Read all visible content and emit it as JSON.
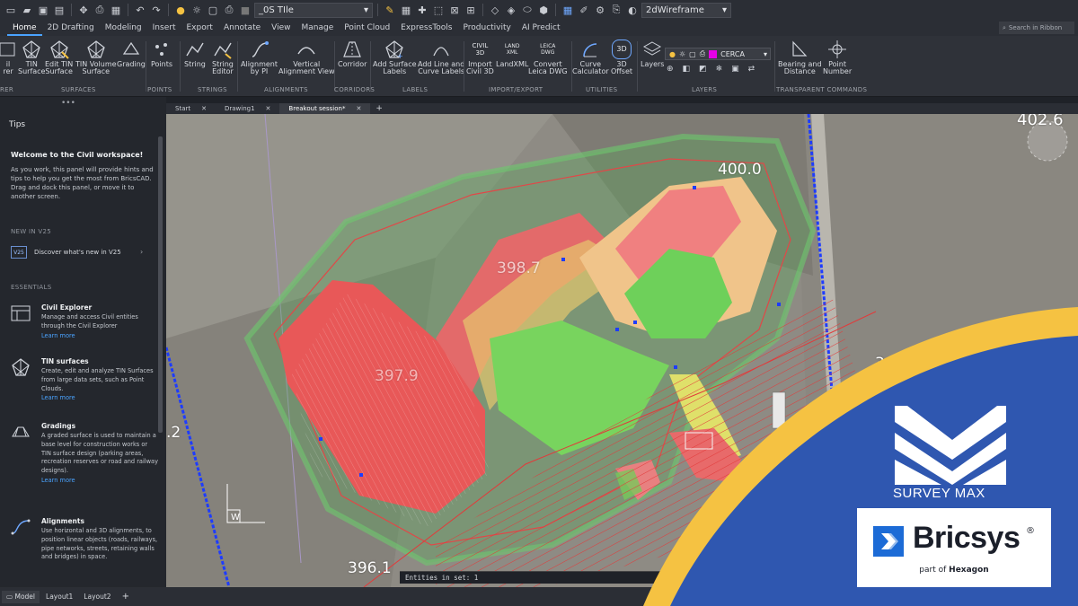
{
  "quick_access": {
    "file_name": "_0S TIle",
    "visual_style": "2dWireframe"
  },
  "menu": {
    "tabs": [
      "Home",
      "2D Drafting",
      "Modeling",
      "Insert",
      "Export",
      "Annotate",
      "View",
      "Manage",
      "Point Cloud",
      "ExpressTools",
      "Productivity",
      "AI Predict"
    ],
    "active": "Home",
    "search_placeholder": "Search in Ribbon"
  },
  "ribbon": {
    "tools": {
      "civil_explorer": "il\nrer",
      "tin_surface": "TIN\nSurface",
      "edit_tin_surface": "Edit TIN\nSurface",
      "tin_volume_surface": "TIN Volume\nSurface",
      "grading": "Grading",
      "points": "Points",
      "string": "String",
      "string_editor": "String\nEditor",
      "alignment_by_pi": "Alignment\nby PI",
      "vertical_alignment_view": "Vertical\nAlignment View",
      "corridor": "Corridor",
      "add_surface_labels": "Add Surface\nLabels",
      "add_line_curve_labels": "Add Line and\nCurve Labels",
      "import_civil3d": "Import\nCivil 3D",
      "landxml": "LandXML",
      "convert_leica": "Convert\nLeica DWG",
      "curve_calculator": "Curve\nCalculator",
      "offset_3d": "3D\nOffset",
      "layers": "Layers",
      "bearing_distance": "Bearing and\nDistance",
      "point_number": "Point\nNumber"
    },
    "icon_tags": {
      "civil": "CIVIL",
      "civil_3d": "3D",
      "land": "LAND",
      "xml": "XML",
      "leica": "LEICA",
      "dwg": "DWG",
      "offset_3d": "3D"
    },
    "groups": {
      "explorer": "RER",
      "surfaces": "SURFACES",
      "points": "POINTS",
      "strings": "STRINGS",
      "alignments": "ALIGNMENTS",
      "corridors": "CORRIDORS",
      "labels": "LABELS",
      "import_export": "IMPORT/EXPORT",
      "utilities": "UTILITIES",
      "layers": "LAYERS",
      "transparent": "TRANSPARENT COMMANDS"
    },
    "current_layer": "CERCA",
    "layer_color": "#e600e6"
  },
  "tips_panel": {
    "title": "Tips",
    "welcome_title": "Welcome to the Civil workspace!",
    "welcome_text": "As you work, this panel will provide hints and tips to help you get the most from BricsCAD. Drag and dock this panel, or move it to another screen.",
    "new_section": "NEW IN V25",
    "v25_badge": "V25",
    "discover": "Discover what's new in V25",
    "essentials_section": "ESSENTIALS",
    "entries": [
      {
        "title": "Civil Explorer",
        "text": "Manage and access Civil entities through the Civil Explorer",
        "link": "Learn more"
      },
      {
        "title": "TIN surfaces",
        "text": "Create, edit and analyze TIN Surfaces from large data sets, such as Point Clouds.",
        "link": "Learn more"
      },
      {
        "title": "Gradings",
        "text": "A graded surface is used to maintain a base level for construction works or TIN surface design (parking areas, recreation reserves or road and railway designs).",
        "link": "Learn more"
      },
      {
        "title": "Alignments",
        "text": "Use horizontal and 3D alignments, to position linear objects (roads, railways, pipe networks, streets, retaining walls and bridges) in space.",
        "link": ""
      }
    ]
  },
  "doc_tabs": [
    "Start",
    "Drawing1",
    "Breakout session*"
  ],
  "active_doc": "Breakout session*",
  "viewport": {
    "elevation_labels": [
      "402.6",
      "400.0",
      "398.7",
      "397.9",
      "396.1",
      ".2",
      "3"
    ],
    "ucs_label": "W",
    "command_line": "Entities in set: 1"
  },
  "layout_tabs": [
    "Model",
    "Layout1",
    "Layout2"
  ],
  "brand": {
    "survey_max": "SURVEY MAX",
    "bricsys": "Bricsys",
    "registered": "®",
    "part_of": "part of",
    "hexagon": "Hexagon",
    "yellow": "#f5c242",
    "blue": "#2f57b0"
  }
}
